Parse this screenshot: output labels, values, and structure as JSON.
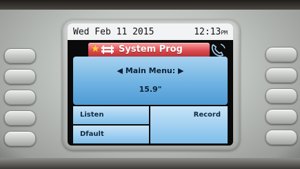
{
  "status_bar": {
    "date": "Wed Feb 11 2015",
    "time": "12:13",
    "ampm": "PM"
  },
  "title_bar": {
    "title": "System Prog",
    "icons": [
      "star-icon",
      "line-icon",
      "phone-icon"
    ]
  },
  "main_panel": {
    "menu_label": "Main Menu:",
    "value": "15.9\""
  },
  "softkeys": {
    "top_left": "Listen",
    "bottom_left": "Dfault",
    "right": "Record"
  },
  "colors": {
    "title_accent": "#d9484c",
    "panel_blue": "#6eb3e3",
    "status_bg": "#f2f3f4"
  }
}
